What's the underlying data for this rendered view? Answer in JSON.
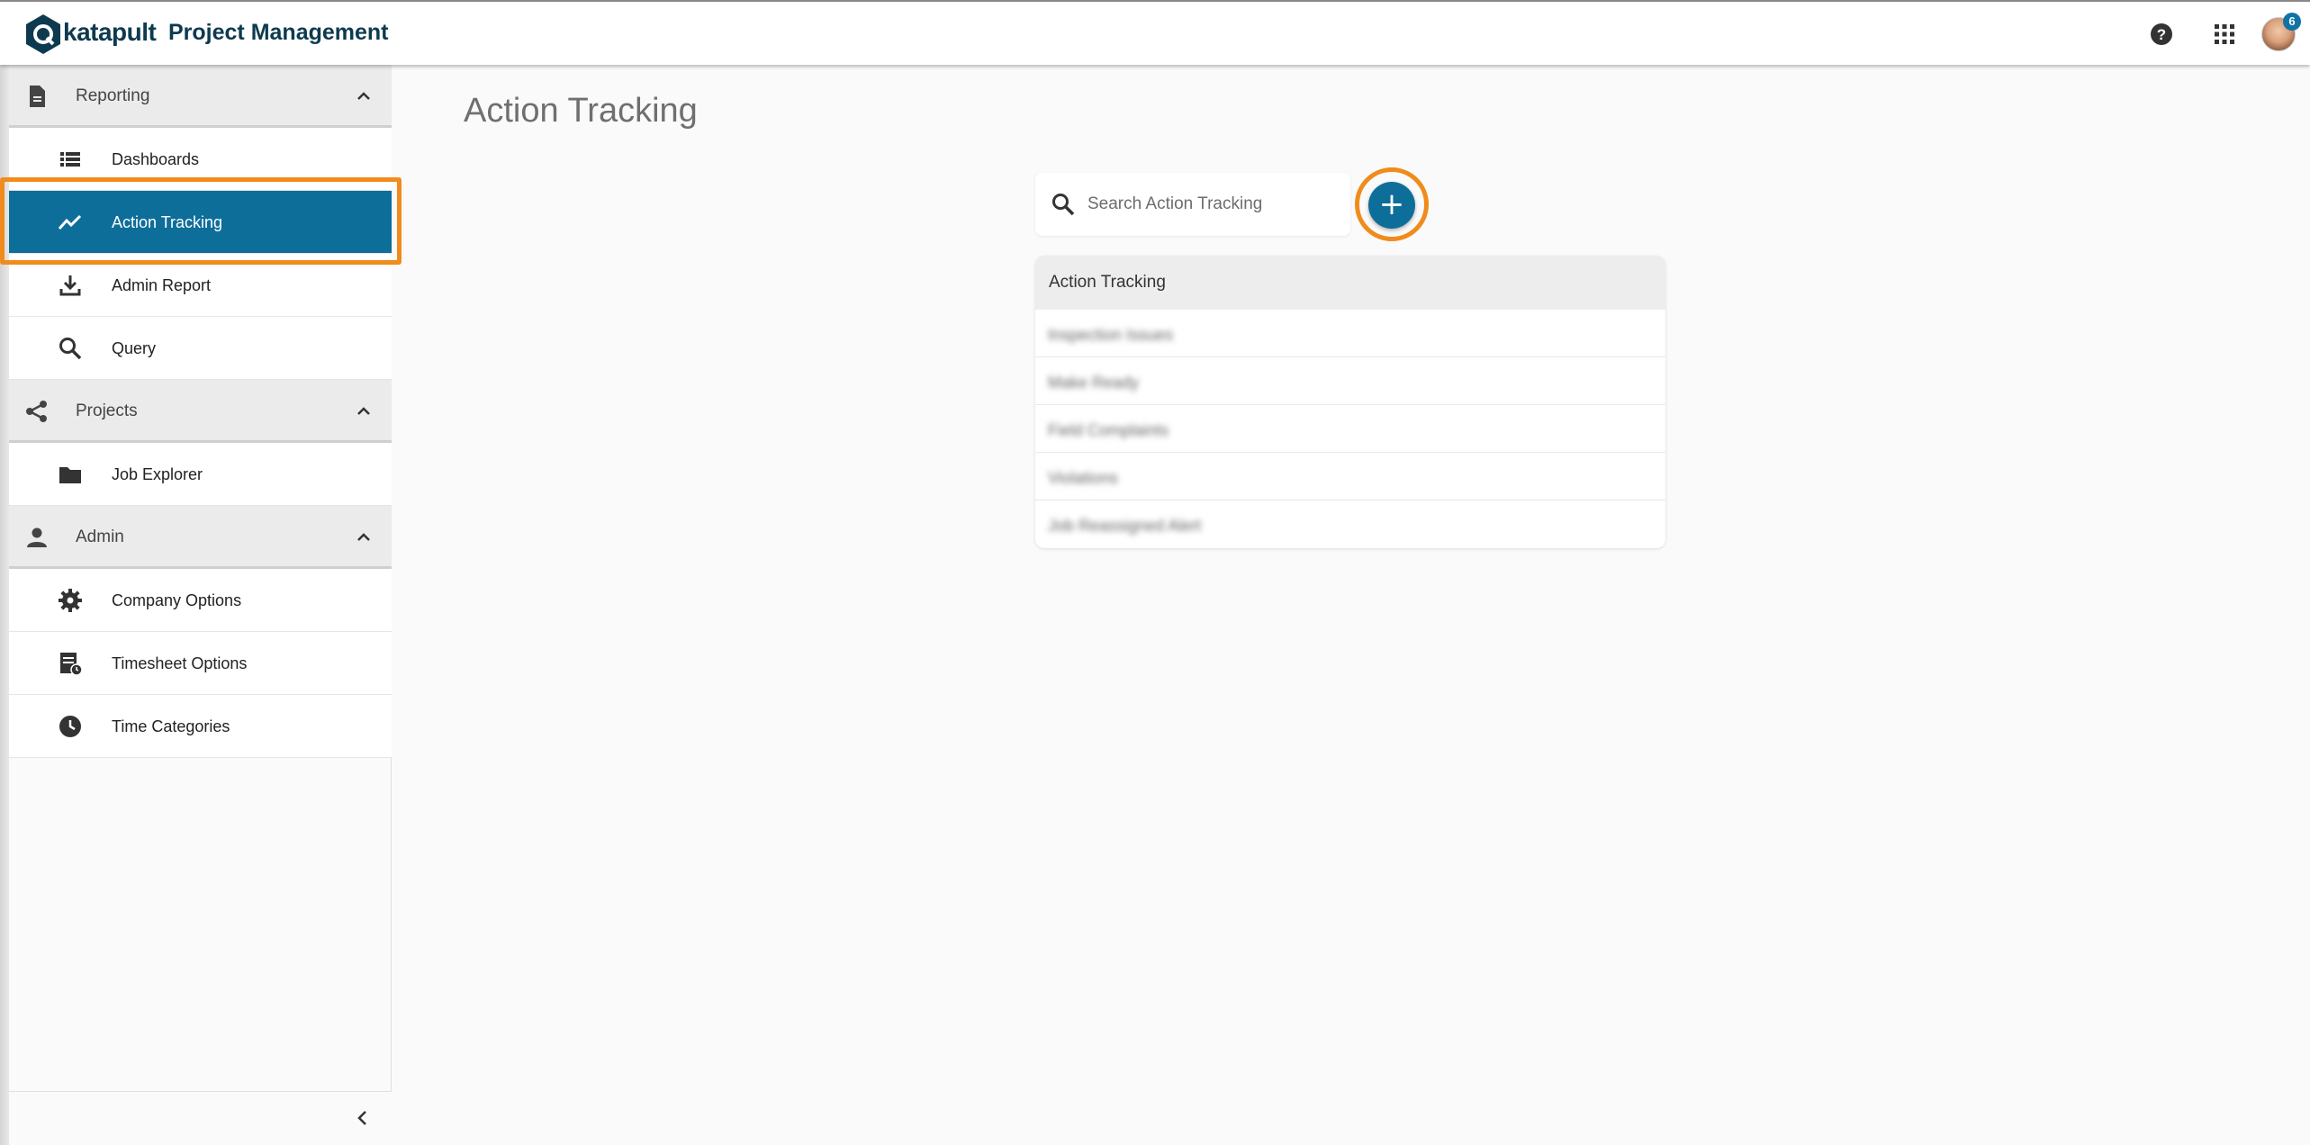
{
  "header": {
    "brand": "katapult",
    "app_title": "Project Management",
    "help_icon": "help-circle-icon",
    "apps_icon": "apps-grid-icon",
    "notification_count": "6"
  },
  "sidebar": {
    "sections": [
      {
        "label": "Reporting",
        "icon": "document-icon",
        "items": [
          {
            "label": "Dashboards",
            "icon": "list-icon"
          },
          {
            "label": "Action Tracking",
            "icon": "trending-up-icon",
            "active": true
          },
          {
            "label": "Admin Report",
            "icon": "download-icon"
          },
          {
            "label": "Query",
            "icon": "search-icon"
          }
        ]
      },
      {
        "label": "Projects",
        "icon": "share-icon",
        "items": [
          {
            "label": "Job Explorer",
            "icon": "folder-icon"
          }
        ]
      },
      {
        "label": "Admin",
        "icon": "person-icon",
        "items": [
          {
            "label": "Company Options",
            "icon": "gear-icon"
          },
          {
            "label": "Timesheet Options",
            "icon": "timesheet-icon"
          },
          {
            "label": "Time Categories",
            "icon": "clock-icon"
          }
        ]
      }
    ]
  },
  "main": {
    "page_title": "Action Tracking",
    "search_placeholder": "Search Action Tracking",
    "add_label": "+",
    "table": {
      "header": "Action Tracking",
      "rows": [
        "Inspection Issues",
        "Make Ready",
        "Field Complaints",
        "Violations",
        "Job Reassigned Alert"
      ]
    }
  },
  "colors": {
    "accent": "#0e6e9a",
    "highlight": "#f08b1c",
    "brand_text": "#0d3a4f"
  }
}
